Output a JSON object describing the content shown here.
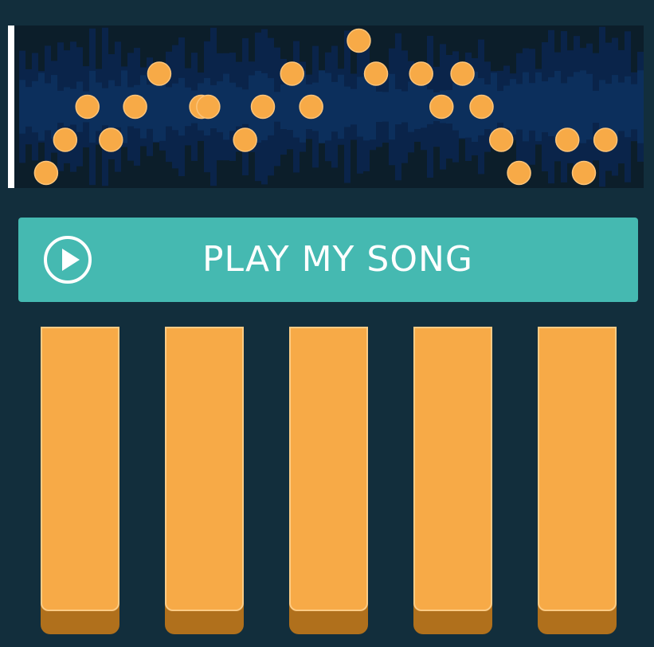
{
  "colors": {
    "background": "#122e3c",
    "track_background": "#0c1e2a",
    "waveform_inner": "#0c2f5c",
    "waveform_outer": "#0a244a",
    "note": "#f7aa47",
    "playhead": "#ffffff",
    "play_button": "#45b9b1",
    "pad_face": "#f7aa47",
    "pad_edge": "#fccb84",
    "pad_shadow": "#b0701c"
  },
  "play_button": {
    "label": "PLAY MY SONG",
    "icon": "play-circle-icon"
  },
  "track": {
    "lanes": 5,
    "notes": [
      {
        "time": 0.06,
        "lane": 5
      },
      {
        "time": 0.09,
        "lane": 4
      },
      {
        "time": 0.125,
        "lane": 3
      },
      {
        "time": 0.162,
        "lane": 4
      },
      {
        "time": 0.2,
        "lane": 3
      },
      {
        "time": 0.238,
        "lane": 2
      },
      {
        "time": 0.304,
        "lane": 3
      },
      {
        "time": 0.315,
        "lane": 3
      },
      {
        "time": 0.373,
        "lane": 4
      },
      {
        "time": 0.401,
        "lane": 3
      },
      {
        "time": 0.447,
        "lane": 2
      },
      {
        "time": 0.477,
        "lane": 3
      },
      {
        "time": 0.552,
        "lane": 1
      },
      {
        "time": 0.579,
        "lane": 2
      },
      {
        "time": 0.65,
        "lane": 2
      },
      {
        "time": 0.682,
        "lane": 3
      },
      {
        "time": 0.715,
        "lane": 2
      },
      {
        "time": 0.745,
        "lane": 3
      },
      {
        "time": 0.776,
        "lane": 4
      },
      {
        "time": 0.804,
        "lane": 5
      },
      {
        "time": 0.88,
        "lane": 4
      },
      {
        "time": 0.906,
        "lane": 5
      },
      {
        "time": 0.94,
        "lane": 4
      }
    ]
  },
  "pads": [
    {
      "id": "pad-1"
    },
    {
      "id": "pad-2"
    },
    {
      "id": "pad-3"
    },
    {
      "id": "pad-4"
    },
    {
      "id": "pad-5"
    }
  ]
}
